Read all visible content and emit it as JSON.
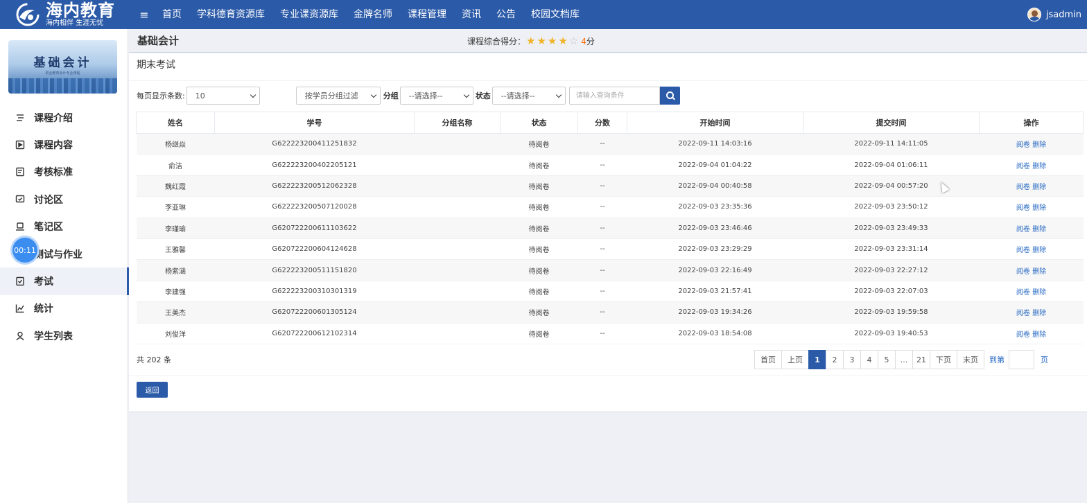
{
  "brand": {
    "name": "海内教育",
    "slogan": "海内相伴 生涯无忧"
  },
  "nav": {
    "toggle": "≡",
    "items": [
      "首页",
      "学科德育资源库",
      "专业课资源库",
      "金牌名师",
      "课程管理",
      "资讯",
      "公告",
      "校园文档库"
    ]
  },
  "user": {
    "name": "jsadmin"
  },
  "course": {
    "cover_title": "基础会计",
    "cover_subtitle": "职业教育会计专业课程",
    "name": "基础会计",
    "rating_label": "课程综合得分：",
    "stars": 4,
    "stars_max": 5,
    "score": "4",
    "score_unit": "分"
  },
  "sidebar": {
    "timer": "00:11",
    "items": [
      {
        "label": "课程介绍",
        "icon": "list-icon"
      },
      {
        "label": "课程内容",
        "icon": "play-box-icon"
      },
      {
        "label": "考核标准",
        "icon": "document-icon"
      },
      {
        "label": "讨论区",
        "icon": "chat-icon"
      },
      {
        "label": "笔记区",
        "icon": "laptop-icon"
      },
      {
        "label": "测试与作业",
        "icon": "timer-icon"
      },
      {
        "label": "考试",
        "icon": "exam-icon"
      },
      {
        "label": "统计",
        "icon": "chart-line-icon"
      },
      {
        "label": "学生列表",
        "icon": "user-icon"
      }
    ],
    "active_index": 6
  },
  "panel": {
    "title": "期末考试"
  },
  "filters": {
    "page_size_label": "每页显示条数:",
    "page_size_value": "10",
    "group_filter_value": "按学员分组过滤",
    "group_label": "分组",
    "group_value": "--请选择--",
    "status_label": "状态",
    "status_value": "--请选择--",
    "search_placeholder": "请输入查询条件"
  },
  "table": {
    "columns": [
      "姓名",
      "学号",
      "分组名称",
      "状态",
      "分数",
      "开始时间",
      "提交时间",
      "操作"
    ],
    "rows": [
      [
        "杨继焱",
        "G622223200411251832",
        "",
        "待阅卷",
        "--",
        "2022-09-11 14:03:16",
        "2022-09-11 14:11:05"
      ],
      [
        "俞洁",
        "G622223200402205121",
        "",
        "待阅卷",
        "--",
        "2022-09-04 01:04:22",
        "2022-09-04 01:06:11"
      ],
      [
        "魏红霞",
        "G622223200512062328",
        "",
        "待阅卷",
        "--",
        "2022-09-04 00:40:58",
        "2022-09-04 00:57:20"
      ],
      [
        "李亚琳",
        "G622223200507120028",
        "",
        "待阅卷",
        "--",
        "2022-09-03 23:35:36",
        "2022-09-03 23:50:12"
      ],
      [
        "李瑾瑜",
        "G620722200611103622",
        "",
        "待阅卷",
        "--",
        "2022-09-03 23:46:46",
        "2022-09-03 23:49:33"
      ],
      [
        "王雅馨",
        "G620722200604124628",
        "",
        "待阅卷",
        "--",
        "2022-09-03 23:29:29",
        "2022-09-03 23:31:14"
      ],
      [
        "杨紫涵",
        "G622223200511151820",
        "",
        "待阅卷",
        "--",
        "2022-09-03 22:16:49",
        "2022-09-03 22:27:12"
      ],
      [
        "李建强",
        "G622223200310301319",
        "",
        "待阅卷",
        "--",
        "2022-09-03 21:57:41",
        "2022-09-03 22:07:03"
      ],
      [
        "王美杰",
        "G620722200601305124",
        "",
        "待阅卷",
        "--",
        "2022-09-03 19:34:26",
        "2022-09-03 19:59:58"
      ],
      [
        "刘俊洋",
        "G620722200612102314",
        "",
        "待阅卷",
        "--",
        "2022-09-03 18:54:08",
        "2022-09-03 19:40:53"
      ]
    ],
    "action_review": "阅卷",
    "action_delete": "删除"
  },
  "pagination": {
    "total": "共 202 条",
    "first": "首页",
    "prev": "上页",
    "pages": [
      "1",
      "2",
      "3",
      "4",
      "5",
      "...",
      "21"
    ],
    "current": "1",
    "next": "下页",
    "last": "末页",
    "goto_label": "到第",
    "goto_unit": "页"
  },
  "back_label": "返回",
  "colors": {
    "primary": "#2b5aa8",
    "link": "#2b6cc4",
    "star": "#f0b428",
    "score": "#ff6a00"
  }
}
